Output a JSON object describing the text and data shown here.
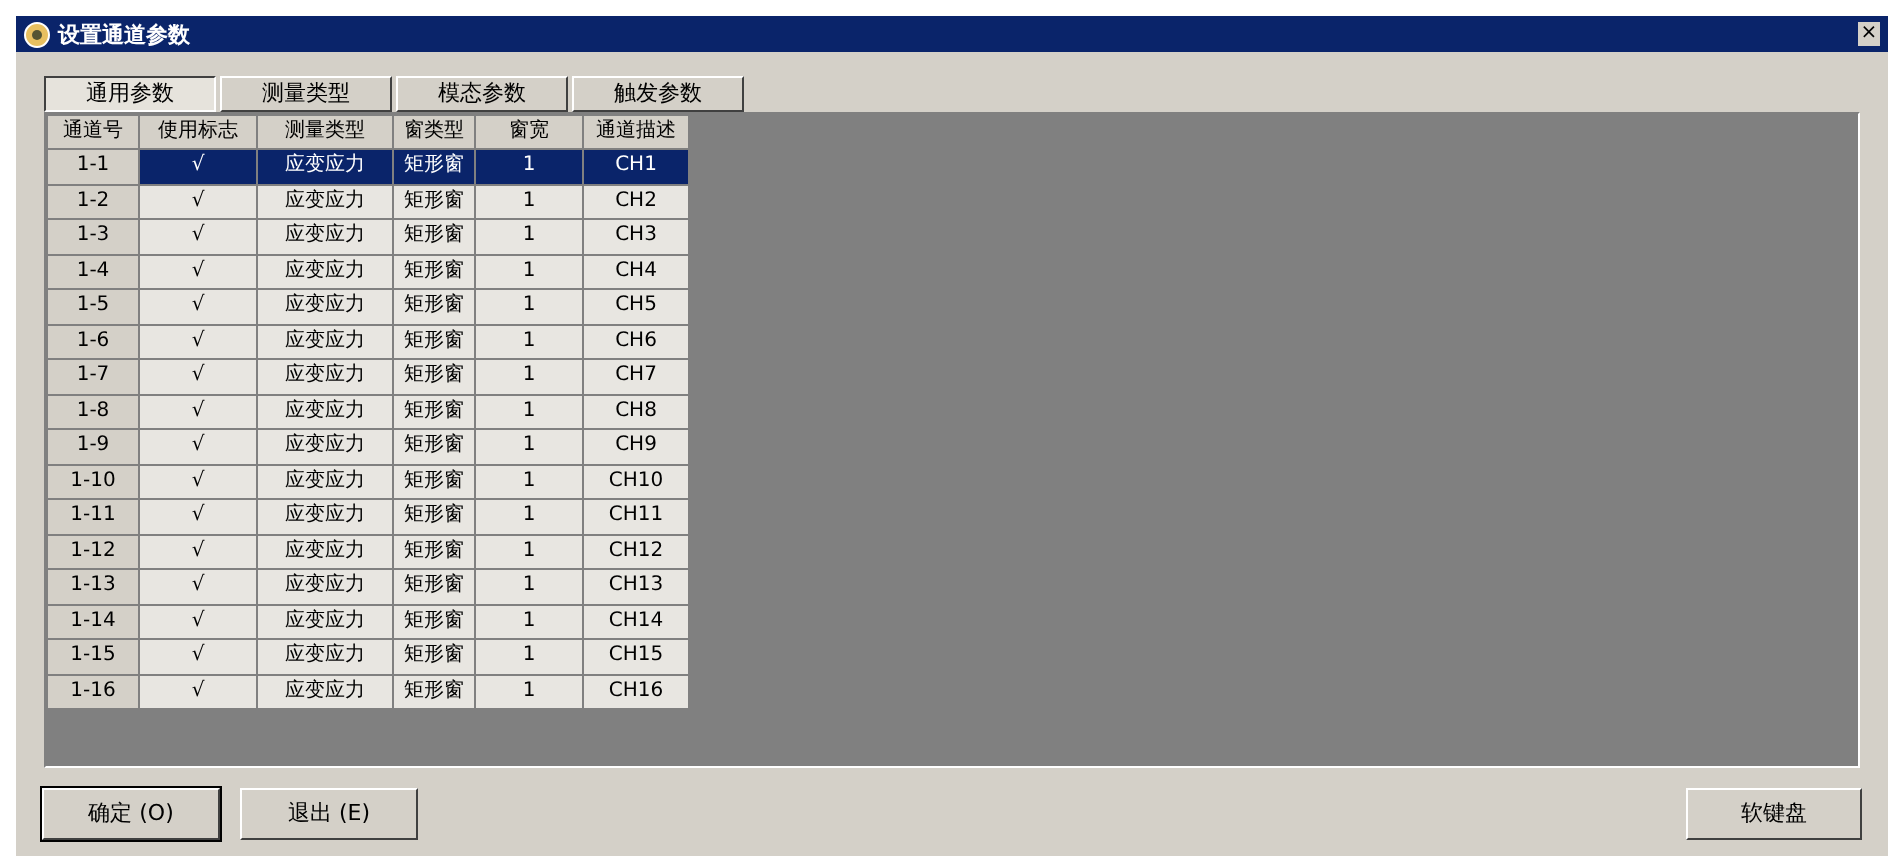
{
  "window": {
    "title": "设置通道参数",
    "close": "×"
  },
  "tabs": [
    {
      "label": "通用参数",
      "selected": true
    },
    {
      "label": "测量类型",
      "selected": false
    },
    {
      "label": "模态参数",
      "selected": false
    },
    {
      "label": "触发参数",
      "selected": false
    }
  ],
  "table": {
    "columns": [
      "通道号",
      "使用标志",
      "测量类型",
      "窗类型",
      "窗宽",
      "通道描述"
    ],
    "rows": [
      {
        "cells": [
          "1-1",
          "√",
          "应变应力",
          "矩形窗",
          "1",
          "CH1"
        ],
        "selected": true
      },
      {
        "cells": [
          "1-2",
          "√",
          "应变应力",
          "矩形窗",
          "1",
          "CH2"
        ],
        "selected": false
      },
      {
        "cells": [
          "1-3",
          "√",
          "应变应力",
          "矩形窗",
          "1",
          "CH3"
        ],
        "selected": false
      },
      {
        "cells": [
          "1-4",
          "√",
          "应变应力",
          "矩形窗",
          "1",
          "CH4"
        ],
        "selected": false
      },
      {
        "cells": [
          "1-5",
          "√",
          "应变应力",
          "矩形窗",
          "1",
          "CH5"
        ],
        "selected": false
      },
      {
        "cells": [
          "1-6",
          "√",
          "应变应力",
          "矩形窗",
          "1",
          "CH6"
        ],
        "selected": false
      },
      {
        "cells": [
          "1-7",
          "√",
          "应变应力",
          "矩形窗",
          "1",
          "CH7"
        ],
        "selected": false
      },
      {
        "cells": [
          "1-8",
          "√",
          "应变应力",
          "矩形窗",
          "1",
          "CH8"
        ],
        "selected": false
      },
      {
        "cells": [
          "1-9",
          "√",
          "应变应力",
          "矩形窗",
          "1",
          "CH9"
        ],
        "selected": false
      },
      {
        "cells": [
          "1-10",
          "√",
          "应变应力",
          "矩形窗",
          "1",
          "CH10"
        ],
        "selected": false
      },
      {
        "cells": [
          "1-11",
          "√",
          "应变应力",
          "矩形窗",
          "1",
          "CH11"
        ],
        "selected": false
      },
      {
        "cells": [
          "1-12",
          "√",
          "应变应力",
          "矩形窗",
          "1",
          "CH12"
        ],
        "selected": false
      },
      {
        "cells": [
          "1-13",
          "√",
          "应变应力",
          "矩形窗",
          "1",
          "CH13"
        ],
        "selected": false
      },
      {
        "cells": [
          "1-14",
          "√",
          "应变应力",
          "矩形窗",
          "1",
          "CH14"
        ],
        "selected": false
      },
      {
        "cells": [
          "1-15",
          "√",
          "应变应力",
          "矩形窗",
          "1",
          "CH15"
        ],
        "selected": false
      },
      {
        "cells": [
          "1-16",
          "√",
          "应变应力",
          "矩形窗",
          "1",
          "CH16"
        ],
        "selected": false
      }
    ]
  },
  "buttons": [
    "确定 (O)",
    "退出 (E)"
  ],
  "keyboard_button": "软键盘"
}
